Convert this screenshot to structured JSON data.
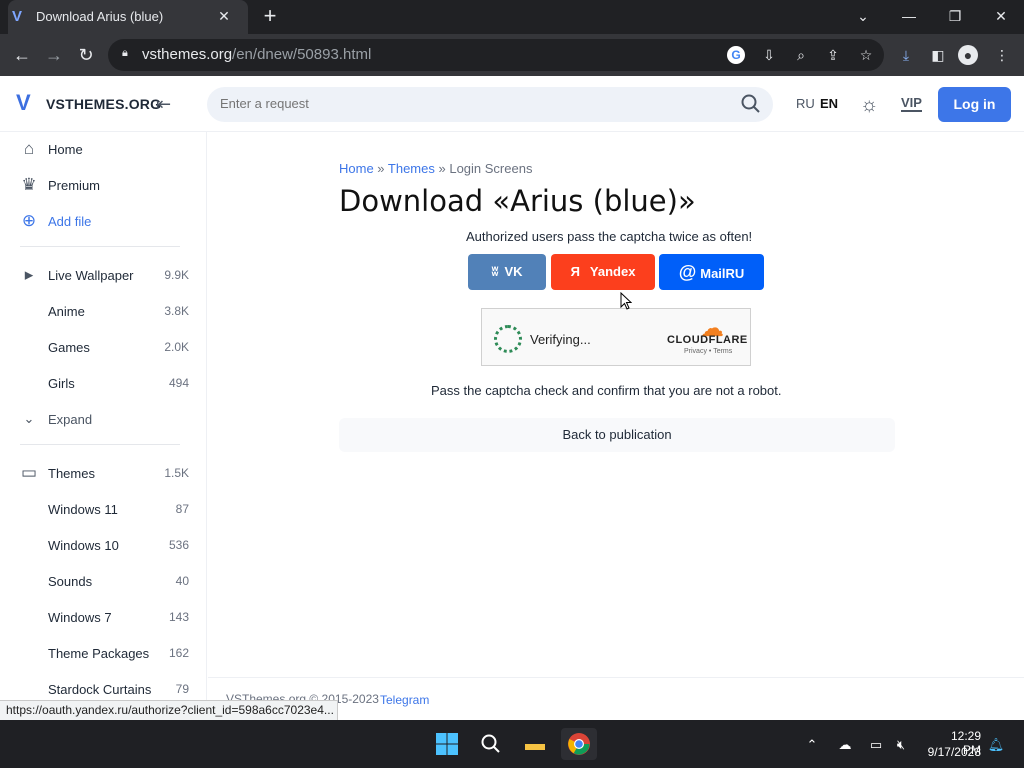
{
  "browser": {
    "tab_title": "Download Arius (blue)",
    "url_host": "vsthemes.org",
    "url_path": "/en/dnew/50893.html"
  },
  "site": {
    "logo_text": "VSTHEMES.ORG",
    "search_placeholder": "Enter a request",
    "lang_ru": "RU",
    "lang_en": "EN",
    "vip": "VIP",
    "login": "Log in"
  },
  "sidebar": {
    "top": [
      {
        "label": "Home",
        "icon": "home-icon"
      },
      {
        "label": "Premium",
        "icon": "crown-icon"
      },
      {
        "label": "Add file",
        "icon": "plus-circle-icon"
      }
    ],
    "wallpaper": {
      "label": "Live Wallpaper",
      "count": "9.9K"
    },
    "wallpaper_sub": [
      {
        "label": "Anime",
        "count": "3.8K"
      },
      {
        "label": "Games",
        "count": "2.0K"
      },
      {
        "label": "Girls",
        "count": "494"
      }
    ],
    "expand": "Expand",
    "themes": {
      "label": "Themes",
      "count": "1.5K"
    },
    "themes_sub": [
      {
        "label": "Windows 11",
        "count": "87"
      },
      {
        "label": "Windows 10",
        "count": "536"
      },
      {
        "label": "Sounds",
        "count": "40"
      },
      {
        "label": "Windows 7",
        "count": "143"
      },
      {
        "label": "Theme Packages",
        "count": "162"
      },
      {
        "label": "Stardock Curtains",
        "count": "79"
      }
    ]
  },
  "main": {
    "breadcrumb": {
      "home": "Home",
      "sep1": " » ",
      "themes": "Themes",
      "sep2": " » ",
      "current": "Login Screens"
    },
    "title": "Download «Arius (blue)»",
    "auth_text": "Authorized users pass the captcha twice as often!",
    "social": {
      "vk": "VK",
      "yandex": "Yandex",
      "mailru": "MailRU"
    },
    "captcha": {
      "status": "Verifying...",
      "brand": "CLOUDFLARE",
      "privacy": "Privacy",
      "dot": "•",
      "terms": "Terms"
    },
    "captcha_msg": "Pass the captcha check and confirm that you are not a robot.",
    "back": "Back to publication"
  },
  "footer": {
    "copyright": "VSThemes.org © 2015-2023",
    "telegram": "Telegram"
  },
  "status_url": "https://oauth.yandex.ru/authorize?client_id=598a6cc7023e4...",
  "taskbar": {
    "time": "12:29 PM",
    "date": "9/17/2023"
  },
  "colors": {
    "vk": "#5181b8",
    "yandex": "#fc3f1d",
    "mailru": "#005ff9",
    "accent": "#3d76e8"
  }
}
